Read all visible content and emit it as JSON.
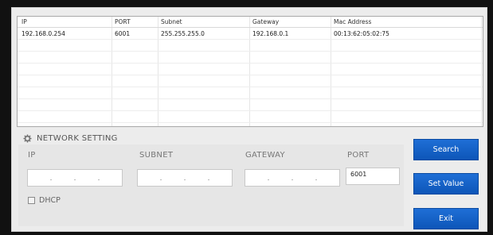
{
  "table": {
    "columns": [
      "IP",
      "PORT",
      "Subnet",
      "Gateway",
      "Mac Address"
    ],
    "rows": [
      [
        "192.168.0.254",
        "6001",
        "255.255.255.0",
        "192.168.0.1",
        "00:13:62:05:02:75"
      ]
    ]
  },
  "settings": {
    "title": "NETWORK SETTING",
    "labels": {
      "ip": "IP",
      "subnet": "SUBNET",
      "gateway": "GATEWAY",
      "port": "PORT"
    },
    "ip_value": ". . .",
    "subnet_value": ". . .",
    "gateway_value": ". . .",
    "port_value": "6001",
    "dhcp_label": "DHCP",
    "dhcp_checked": false
  },
  "buttons": {
    "search": "Search",
    "set_value": "Set Value",
    "exit": "Exit"
  },
  "colors": {
    "accent": "#0d56b8",
    "window": "#ececec",
    "frame": "#111111"
  },
  "icons": {
    "section": "gear-icon"
  }
}
